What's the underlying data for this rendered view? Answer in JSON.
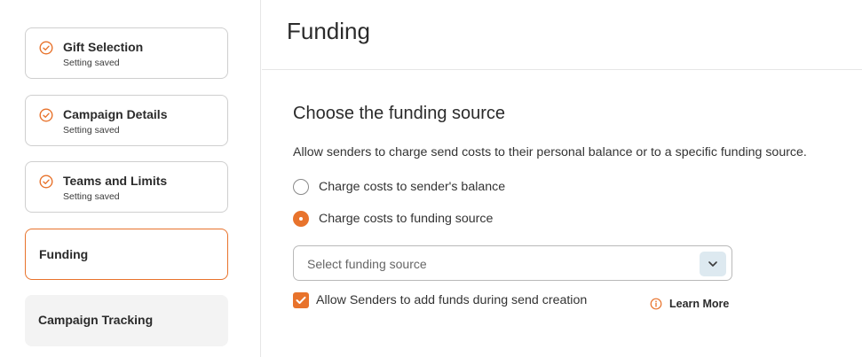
{
  "sidebar": {
    "steps": [
      {
        "title": "Gift Selection",
        "status": "Setting saved",
        "icon": "check-circle-icon"
      },
      {
        "title": "Campaign Details",
        "status": "Setting saved",
        "icon": "check-circle-icon"
      },
      {
        "title": "Teams and Limits",
        "status": "Setting saved",
        "icon": "check-circle-icon"
      },
      {
        "title": "Funding"
      },
      {
        "title": "Campaign Tracking"
      }
    ]
  },
  "header": {
    "title": "Funding"
  },
  "funding": {
    "section_title": "Choose the funding source",
    "description": "Allow senders to charge send costs to their personal balance or to a specific funding source.",
    "options": [
      {
        "label": "Charge costs to sender's balance",
        "selected": false
      },
      {
        "label": "Charge costs to funding source",
        "selected": true
      }
    ],
    "select": {
      "placeholder": "Select funding source",
      "icon": "chevron-down-icon"
    },
    "allow_add_funds": {
      "label": "Allow Senders to add funds during send creation",
      "checked": true
    },
    "learn_more": {
      "label": "Learn More",
      "icon": "info-icon"
    }
  },
  "colors": {
    "accent": "#e8732c",
    "caret_bg": "#dde9f0",
    "muted_step_bg": "#f3f3f3",
    "border": "#cfcfcf"
  }
}
